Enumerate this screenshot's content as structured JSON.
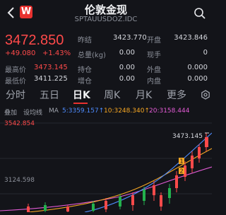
{
  "header": {
    "title": "伦敦金现",
    "subtitle": "SPTAUUSDOZ.IDC",
    "logo_text": "W",
    "brand_color": "#e8312f"
  },
  "quote": {
    "price": "3472.850",
    "change": "+49.080",
    "change_pct": "+1.43%",
    "rows": [
      [
        {
          "label": "昨结",
          "value": "3423.770"
        },
        {
          "label": "开盘",
          "value": "3423.846"
        }
      ],
      [
        {
          "label": "总量(kg)",
          "value": "0.00"
        },
        {
          "label": "现手",
          "value": "0"
        }
      ],
      [
        {
          "label": "最高价",
          "value": "3473.145"
        },
        {
          "label": "持仓",
          "value": "0.00"
        },
        {
          "label": "外盘",
          "value": "0.000"
        }
      ],
      [
        {
          "label": "最低价",
          "value": "3411.225"
        },
        {
          "label": "增仓",
          "value": "0.00"
        },
        {
          "label": "内盘",
          "value": "0.000"
        }
      ]
    ]
  },
  "tabs": [
    "分时",
    "五日",
    "日K",
    "周K",
    "月K",
    "更多"
  ],
  "active_tab": "日K",
  "indicators": {
    "overlay": "叠加",
    "settings": "设均线",
    "ma_label": "MA",
    "ma5": "5:3359.157↑",
    "ma10": "10:3248.340↑",
    "ma20": "20:3158.444"
  },
  "chart": {
    "y_top_label": "3542.854",
    "y_mid_label": "3124.598",
    "high_label": "3473.145",
    "marker_1": "1",
    "marker_2": "2",
    "colors": {
      "up": "#ff4a4a",
      "down": "#23b14d",
      "ma5": "#4e8cff",
      "ma10": "#f5a623",
      "ma20": "#e35bd5"
    }
  }
}
